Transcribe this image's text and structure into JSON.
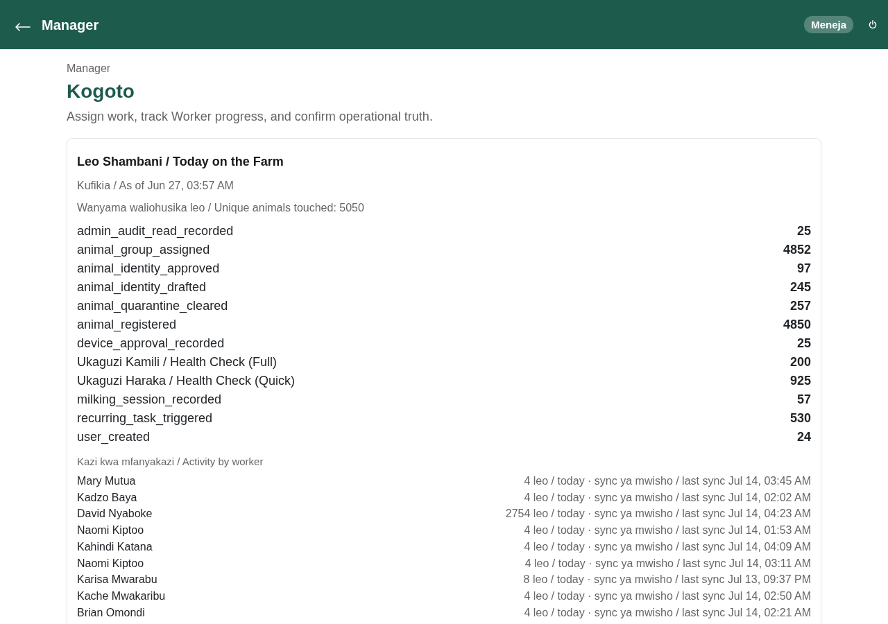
{
  "header": {
    "title": "Manager",
    "role_badge": "Meneja"
  },
  "page": {
    "eyebrow": "Manager",
    "title": "Kogoto",
    "subtitle": "Assign work, track Worker progress, and confirm operational truth."
  },
  "card": {
    "title": "Leo Shambani / Today on the Farm",
    "as_of": "Kufikia / As of Jun 27, 03:57 AM",
    "unique_animals": "Wanyama waliohusika leo / Unique animals touched: 5050",
    "metrics": [
      {
        "label": "admin_audit_read_recorded",
        "value": "25"
      },
      {
        "label": "animal_group_assigned",
        "value": "4852"
      },
      {
        "label": "animal_identity_approved",
        "value": "97"
      },
      {
        "label": "animal_identity_drafted",
        "value": "245"
      },
      {
        "label": "animal_quarantine_cleared",
        "value": "257"
      },
      {
        "label": "animal_registered",
        "value": "4850"
      },
      {
        "label": "device_approval_recorded",
        "value": "25"
      },
      {
        "label": "Ukaguzi Kamili / Health Check (Full)",
        "value": "200"
      },
      {
        "label": "Ukaguzi Haraka / Health Check (Quick)",
        "value": "925"
      },
      {
        "label": "milking_session_recorded",
        "value": "57"
      },
      {
        "label": "recurring_task_triggered",
        "value": "530"
      },
      {
        "label": "user_created",
        "value": "24"
      }
    ],
    "workers_heading": "Kazi kwa mfanyakazi / Activity by worker",
    "workers": [
      {
        "name": "Mary Mutua",
        "activity": "4 leo / today · sync ya mwisho / last sync Jul 14, 03:45 AM"
      },
      {
        "name": "Kadzo Baya",
        "activity": "4 leo / today · sync ya mwisho / last sync Jul 14, 02:02 AM"
      },
      {
        "name": "David Nyaboke",
        "activity": "2754 leo / today · sync ya mwisho / last sync Jul 14, 04:23 AM"
      },
      {
        "name": "Naomi Kiptoo",
        "activity": "4 leo / today · sync ya mwisho / last sync Jul 14, 01:53 AM"
      },
      {
        "name": "Kahindi Katana",
        "activity": "4 leo / today · sync ya mwisho / last sync Jul 14, 04:09 AM"
      },
      {
        "name": "Naomi Kiptoo",
        "activity": "4 leo / today · sync ya mwisho / last sync Jul 14, 03:11 AM"
      },
      {
        "name": "Karisa Mwarabu",
        "activity": "8 leo / today · sync ya mwisho / last sync Jul 13, 09:37 PM"
      },
      {
        "name": "Kache Mwakaribu",
        "activity": "4 leo / today · sync ya mwisho / last sync Jul 14, 02:50 AM"
      },
      {
        "name": "Brian Omondi",
        "activity": "4 leo / today · sync ya mwisho / last sync Jul 14, 02:21 AM"
      }
    ]
  }
}
